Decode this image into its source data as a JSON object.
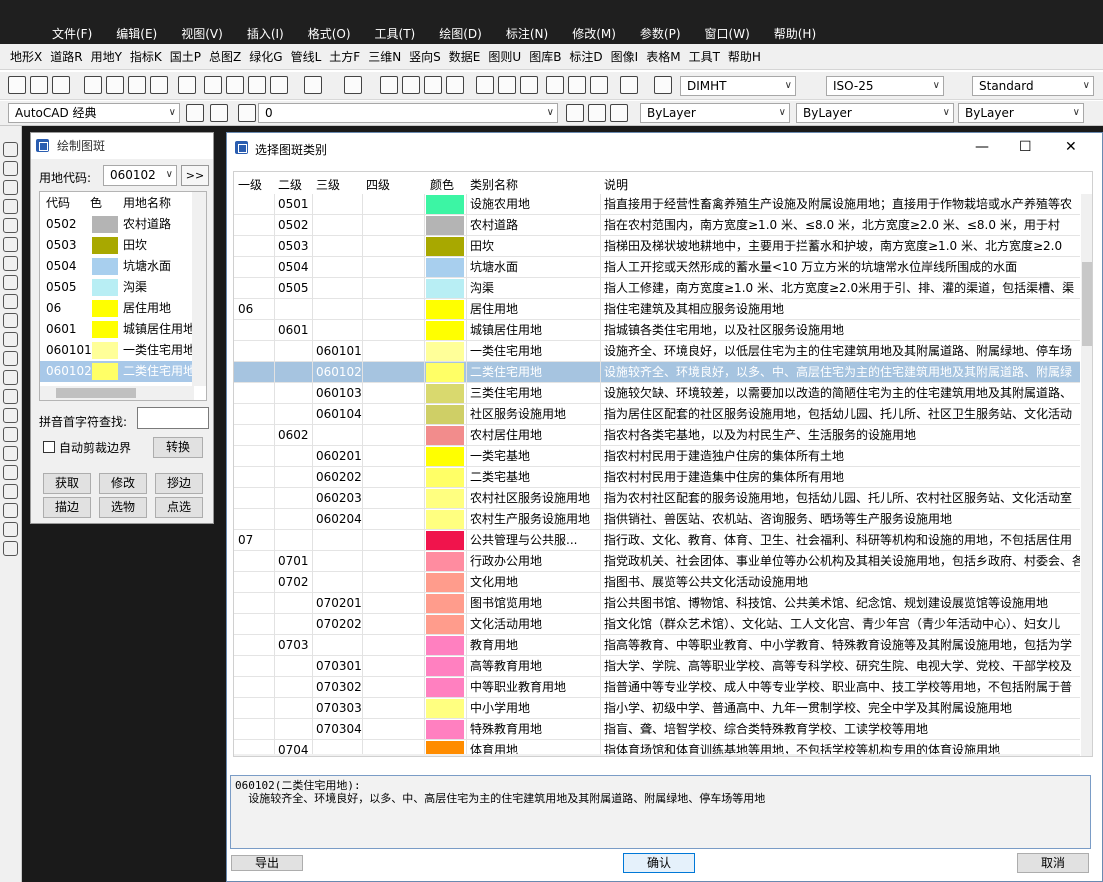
{
  "menu": [
    "文件(F)",
    "编辑(E)",
    "视图(V)",
    "插入(I)",
    "格式(O)",
    "工具(T)",
    "绘图(D)",
    "标注(N)",
    "修改(M)",
    "参数(P)",
    "窗口(W)",
    "帮助(H)"
  ],
  "menu2": [
    "地形X",
    "道路R",
    "用地Y",
    "指标K",
    "国土P",
    "总图Z",
    "绿化G",
    "管线L",
    "土方F",
    "三维N",
    "竖向S",
    "数据E",
    "图则U",
    "图库B",
    "标注D",
    "图像I",
    "表格M",
    "工具T",
    "帮助H"
  ],
  "toolbar": {
    "dimstyle": "DIMHT",
    "textstyle": "ISO-25",
    "tablestyle": "Standard",
    "workspace": "AutoCAD 经典",
    "layer": "0",
    "color": "ByLayer",
    "linetype": "ByLayer",
    "lineweight": "ByLayer"
  },
  "panel": {
    "title": "绘制图斑",
    "code_label": "用地代码:",
    "code_value": "060102",
    "next_label": ">>",
    "headers": [
      "代码",
      "色",
      "用地名称"
    ],
    "rows": [
      {
        "code": "0502",
        "color": "#b4b4b4",
        "name": "农村道路"
      },
      {
        "code": "0503",
        "color": "#a8a800",
        "name": "田坎"
      },
      {
        "code": "0504",
        "color": "#a8cfee",
        "name": "坑塘水面"
      },
      {
        "code": "0505",
        "color": "#b8eef4",
        "name": "沟渠"
      },
      {
        "code": "06",
        "color": "#ffff00",
        "name": "居住用地"
      },
      {
        "code": "0601",
        "color": "#ffff00",
        "name": "城镇居住用地"
      },
      {
        "code": "060101",
        "color": "#ffff99",
        "name": "一类住宅用地"
      },
      {
        "code": "060102",
        "color": "#ffff66",
        "name": "二类住宅用地"
      }
    ],
    "pinyin_label": "拼音首字符查找:",
    "autoclip_label": "自动剪裁边界",
    "convert_label": "转换",
    "buttons": [
      "获取",
      "修改",
      "拶边",
      "描边",
      "选物",
      "点选"
    ]
  },
  "dialog": {
    "title": "选择图斑类别",
    "headers": [
      "一级",
      "二级",
      "三级",
      "四级",
      "颜色",
      "类别名称",
      "说明"
    ],
    "rows": [
      {
        "l1": "",
        "l2": "0501",
        "l3": "",
        "l4": "",
        "color": "#3cf5a4",
        "name": "设施农用地",
        "desc": "指直接用于经营性畜禽养殖生产设施及附属设施用地；直接用于作物栽培或水产养殖等农"
      },
      {
        "l1": "",
        "l2": "0502",
        "l3": "",
        "l4": "",
        "color": "#b4b4b4",
        "name": "农村道路",
        "desc": "指在农村范围内，南方宽度≥1.0 米、≤8.0 米，北方宽度≥2.0 米、≤8.0 米，用于村"
      },
      {
        "l1": "",
        "l2": "0503",
        "l3": "",
        "l4": "",
        "color": "#a8a800",
        "name": "田坎",
        "desc": "指梯田及梯状坡地耕地中，主要用于拦蓄水和护坡，南方宽度≥1.0 米、北方宽度≥2.0"
      },
      {
        "l1": "",
        "l2": "0504",
        "l3": "",
        "l4": "",
        "color": "#a8cfee",
        "name": "坑塘水面",
        "desc": "指人工开挖或天然形成的蓄水量<10 万立方米的坑塘常水位岸线所围成的水面"
      },
      {
        "l1": "",
        "l2": "0505",
        "l3": "",
        "l4": "",
        "color": "#b8eef4",
        "name": "沟渠",
        "desc": "指人工修建，南方宽度≥1.0 米、北方宽度≥2.0米用于引、排、灌的渠道，包括渠槽、渠"
      },
      {
        "l1": "06",
        "l2": "",
        "l3": "",
        "l4": "",
        "color": "#ffff00",
        "name": "居住用地",
        "desc": "指住宅建筑及其相应服务设施用地"
      },
      {
        "l1": "",
        "l2": "0601",
        "l3": "",
        "l4": "",
        "color": "#ffff00",
        "name": "城镇居住用地",
        "desc": "指城镇各类住宅用地，以及社区服务设施用地"
      },
      {
        "l1": "",
        "l2": "",
        "l3": "060101",
        "l4": "",
        "color": "#ffff99",
        "name": "一类住宅用地",
        "desc": "设施齐全、环境良好，以低层住宅为主的住宅建筑用地及其附属道路、附属绿地、停车场"
      },
      {
        "l1": "",
        "l2": "",
        "l3": "060102",
        "l4": "",
        "color": "#ffff66",
        "name": "二类住宅用地",
        "desc": "设施较齐全、环境良好，以多、中、高层住宅为主的住宅建筑用地及其附属道路、附属绿",
        "selected": true
      },
      {
        "l1": "",
        "l2": "",
        "l3": "060103",
        "l4": "",
        "color": "#d9d96e",
        "name": "三类住宅用地",
        "desc": "设施较欠缺、环境较差，以需要加以改造的简陋住宅为主的住宅建筑用地及其附属道路、"
      },
      {
        "l1": "",
        "l2": "",
        "l3": "060104",
        "l4": "",
        "color": "#cfcf66",
        "name": "社区服务设施用地",
        "desc": "指为居住区配套的社区服务设施用地，包括幼儿园、托儿所、社区卫生服务站、文化活动"
      },
      {
        "l1": "",
        "l2": "0602",
        "l3": "",
        "l4": "",
        "color": "#f28c8c",
        "name": "农村居住用地",
        "desc": "指农村各类宅基地，以及为村民生产、生活服务的设施用地"
      },
      {
        "l1": "",
        "l2": "",
        "l3": "060201",
        "l4": "",
        "color": "#ffff00",
        "name": "一类宅基地",
        "desc": "指农村村民用于建造独户住房的集体所有土地"
      },
      {
        "l1": "",
        "l2": "",
        "l3": "060202",
        "l4": "",
        "color": "#ffff66",
        "name": "二类宅基地",
        "desc": "指农村村民用于建造集中住房的集体所有用地"
      },
      {
        "l1": "",
        "l2": "",
        "l3": "060203",
        "l4": "",
        "color": "#ffff80",
        "name": "农村社区服务设施用地",
        "desc": "指为农村社区配套的服务设施用地，包括幼儿园、托儿所、农村社区服务站、文化活动室"
      },
      {
        "l1": "",
        "l2": "",
        "l3": "060204",
        "l4": "",
        "color": "#ffff80",
        "name": "农村生产服务设施用地",
        "desc": "指供销社、兽医站、农机站、咨询服务、晒场等生产服务设施用地"
      },
      {
        "l1": "07",
        "l2": "",
        "l3": "",
        "l4": "",
        "color": "#f0144c",
        "name": "公共管理与公共服...",
        "desc": "指行政、文化、教育、体育、卫生、社会福利、科研等机构和设施的用地，不包括居住用"
      },
      {
        "l1": "",
        "l2": "0701",
        "l3": "",
        "l4": "",
        "color": "#ff8ca0",
        "name": "行政办公用地",
        "desc": "指党政机关、社会团体、事业单位等办公机构及其相关设施用地，包括乡政府、村委会、各"
      },
      {
        "l1": "",
        "l2": "0702",
        "l3": "",
        "l4": "",
        "color": "#ff9c8c",
        "name": "文化用地",
        "desc": "指图书、展览等公共文化活动设施用地"
      },
      {
        "l1": "",
        "l2": "",
        "l3": "070201",
        "l4": "",
        "color": "#ff9c8c",
        "name": "图书馆览用地",
        "desc": "指公共图书馆、博物馆、科技馆、公共美术馆、纪念馆、规划建设展览馆等设施用地"
      },
      {
        "l1": "",
        "l2": "",
        "l3": "070202",
        "l4": "",
        "color": "#ff9c8c",
        "name": "文化活动用地",
        "desc": "指文化馆（群众艺术馆）、文化站、工人文化宫、青少年宫（青少年活动中心）、妇女儿"
      },
      {
        "l1": "",
        "l2": "0703",
        "l3": "",
        "l4": "",
        "color": "#ff80c0",
        "name": "教育用地",
        "desc": "指高等教育、中等职业教育、中小学教育、特殊教育设施等及其附属设施用地，包括为学"
      },
      {
        "l1": "",
        "l2": "",
        "l3": "070301",
        "l4": "",
        "color": "#ff80c0",
        "name": "高等教育用地",
        "desc": "指大学、学院、高等职业学校、高等专科学校、研究生院、电视大学、党校、干部学校及"
      },
      {
        "l1": "",
        "l2": "",
        "l3": "070302",
        "l4": "",
        "color": "#ff80c0",
        "name": "中等职业教育用地",
        "desc": "指普通中等专业学校、成人中等专业学校、职业高中、技工学校等用地，不包括附属于普"
      },
      {
        "l1": "",
        "l2": "",
        "l3": "070303",
        "l4": "",
        "color": "#ffff80",
        "name": "中小学用地",
        "desc": "指小学、初级中学、普通高中、九年一贯制学校、完全中学及其附属设施用地"
      },
      {
        "l1": "",
        "l2": "",
        "l3": "070304",
        "l4": "",
        "color": "#ff80c0",
        "name": "特殊教育用地",
        "desc": "指盲、聋、培智学校、综合类特殊教育学校、工读学校等用地"
      },
      {
        "l1": "",
        "l2": "0704",
        "l3": "",
        "l4": "",
        "color": "#ff8c00",
        "name": "体育用地",
        "desc": "指体育场馆和体育训练基地等用地，不包括学校等机构专用的体育设施用地"
      }
    ],
    "description": "060102(二类住宅用地):\n  设施较齐全、环境良好，以多、中、高层住宅为主的住宅建筑用地及其附属道路、附属绿地、停车场等用地",
    "ok_label": "确认",
    "cancel_label": "取消",
    "export_label": "导出"
  }
}
